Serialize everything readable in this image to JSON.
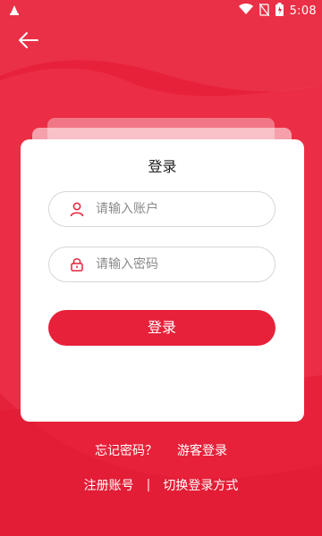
{
  "status_bar": {
    "time": "5:08",
    "icons": [
      "notification-icon",
      "wifi-icon",
      "no-sim-icon",
      "battery-icon"
    ]
  },
  "nav": {
    "back_icon": "back-arrow-icon"
  },
  "login_card": {
    "title": "登录",
    "account_placeholder": "请输入账户",
    "password_placeholder": "请输入密码",
    "submit_label": "登录"
  },
  "links": {
    "forgot_password": "忘记密码？",
    "guest_login": "游客登录",
    "register": "注册账号",
    "separator": "|",
    "switch_login": "切换登录方式"
  },
  "colors": {
    "accent": "#e8213a",
    "background": "#e8213a",
    "card": "#ffffff"
  }
}
